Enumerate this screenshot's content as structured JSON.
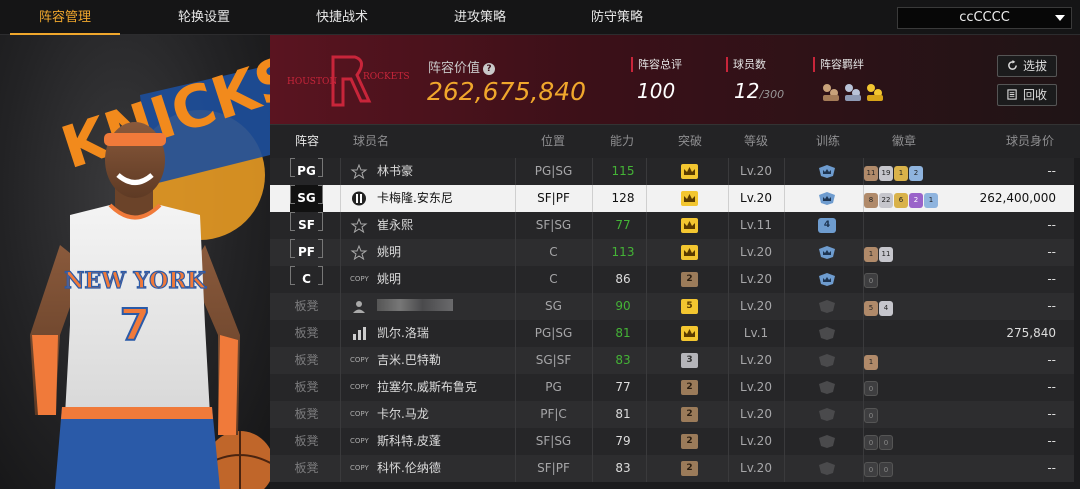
{
  "nav": {
    "tabs": [
      {
        "label": "阵容管理"
      },
      {
        "label": "轮换设置"
      },
      {
        "label": "快捷战术"
      },
      {
        "label": "进攻策略"
      },
      {
        "label": "防守策略"
      }
    ],
    "account_select": "ccCCCC"
  },
  "portrait": {
    "jersey_text": "NEW YORK",
    "jersey_number": "7",
    "background_text": "KNICKS"
  },
  "header": {
    "team_logo_left": "HOUSTON",
    "team_logo_right": "ROCKETS",
    "value_label": "阵容价值",
    "value": "262,675,840",
    "overall_label": "阵容总评",
    "overall": "100",
    "count_label": "球员数",
    "count": "12",
    "count_max": "/300",
    "bond_label": "阵容羁绊",
    "btn_draft": "选拔",
    "btn_recycle": "回收"
  },
  "table": {
    "headers": {
      "lineup": "阵容",
      "name": "球员名",
      "position": "位置",
      "ability": "能力",
      "breakthrough": "突破",
      "level": "等级",
      "training": "训练",
      "badges": "徽章",
      "price": "球员身价"
    },
    "rows": [
      {
        "slot": "PG",
        "icon": "star",
        "name": "林书豪",
        "pos": "PG|SG",
        "ability": "115",
        "green": true,
        "brk": "crown",
        "lvl": "Lv.20",
        "train": "crown",
        "badges": [
          [
            "b",
            "11"
          ],
          [
            "s",
            "19"
          ],
          [
            "g",
            "1"
          ],
          [
            "c",
            "2"
          ]
        ],
        "price": "--"
      },
      {
        "slot": "SG",
        "icon": "jersey",
        "name": "卡梅隆.安东尼",
        "pos": "SF|PF",
        "ability": "128",
        "green": false,
        "brk": "crown",
        "lvl": "Lv.20",
        "train": "crown",
        "badges": [
          [
            "b",
            "8"
          ],
          [
            "s",
            "22"
          ],
          [
            "g",
            "6"
          ],
          [
            "p",
            "2"
          ],
          [
            "c",
            "1"
          ]
        ],
        "price": "262,400,000"
      },
      {
        "slot": "SF",
        "icon": "star",
        "name": "崔永熙",
        "pos": "SF|SG",
        "ability": "77",
        "green": true,
        "brk": "crown",
        "lvl": "Lv.11",
        "train": "4",
        "badges": [],
        "price": "--"
      },
      {
        "slot": "PF",
        "icon": "star",
        "name": "姚明",
        "pos": "C",
        "ability": "113",
        "green": true,
        "brk": "crown",
        "lvl": "Lv.20",
        "train": "crown",
        "badges": [
          [
            "b",
            "1"
          ],
          [
            "s",
            "11"
          ]
        ],
        "price": "--"
      },
      {
        "slot": "C",
        "icon": "copy",
        "name": "姚明",
        "pos": "C",
        "ability": "86",
        "green": false,
        "brk": "2",
        "lvl": "Lv.20",
        "train": "crown",
        "badges": [
          [
            "d",
            "0"
          ]
        ],
        "price": "--"
      },
      {
        "slot": "板凳",
        "icon": "person",
        "name": "",
        "pos": "SG",
        "ability": "90",
        "green": true,
        "brk": "5",
        "lvl": "Lv.20",
        "train": "empty",
        "badges": [
          [
            "b",
            "5"
          ],
          [
            "s",
            "4"
          ]
        ],
        "price": "--"
      },
      {
        "slot": "板凳",
        "icon": "bars",
        "name": "凯尔.洛瑞",
        "pos": "PG|SG",
        "ability": "81",
        "green": true,
        "brk": "crown",
        "lvl": "Lv.1",
        "train": "empty",
        "badges": [],
        "price": "275,840"
      },
      {
        "slot": "板凳",
        "icon": "copy",
        "name": "吉米.巴特勒",
        "pos": "SG|SF",
        "ability": "83",
        "green": true,
        "brk": "3",
        "lvl": "Lv.20",
        "train": "empty",
        "badges": [
          [
            "b",
            "1"
          ]
        ],
        "price": "--"
      },
      {
        "slot": "板凳",
        "icon": "copy",
        "name": "拉塞尔.威斯布鲁克",
        "pos": "PG",
        "ability": "77",
        "green": false,
        "brk": "2",
        "lvl": "Lv.20",
        "train": "empty",
        "badges": [
          [
            "d",
            "0"
          ]
        ],
        "price": "--"
      },
      {
        "slot": "板凳",
        "icon": "copy",
        "name": "卡尔.马龙",
        "pos": "PF|C",
        "ability": "81",
        "green": false,
        "brk": "2",
        "lvl": "Lv.20",
        "train": "empty",
        "badges": [
          [
            "d",
            "0"
          ]
        ],
        "price": "--"
      },
      {
        "slot": "板凳",
        "icon": "copy",
        "name": "斯科特.皮蓬",
        "pos": "SF|SG",
        "ability": "79",
        "green": false,
        "brk": "2",
        "lvl": "Lv.20",
        "train": "empty",
        "badges": [
          [
            "d",
            "0"
          ],
          [
            "d",
            "0"
          ]
        ],
        "price": "--"
      },
      {
        "slot": "板凳",
        "icon": "copy",
        "name": "科怀.伦纳德",
        "pos": "SF|PF",
        "ability": "83",
        "green": false,
        "brk": "2",
        "lvl": "Lv.20",
        "train": "empty",
        "badges": [
          [
            "d",
            "0"
          ],
          [
            "d",
            "0"
          ]
        ],
        "price": "--"
      }
    ],
    "copy_icon_text": "COPY"
  },
  "colors": {
    "accent": "#f0a72c",
    "ability_green": "#44b336",
    "team_red": "#c8253a"
  }
}
